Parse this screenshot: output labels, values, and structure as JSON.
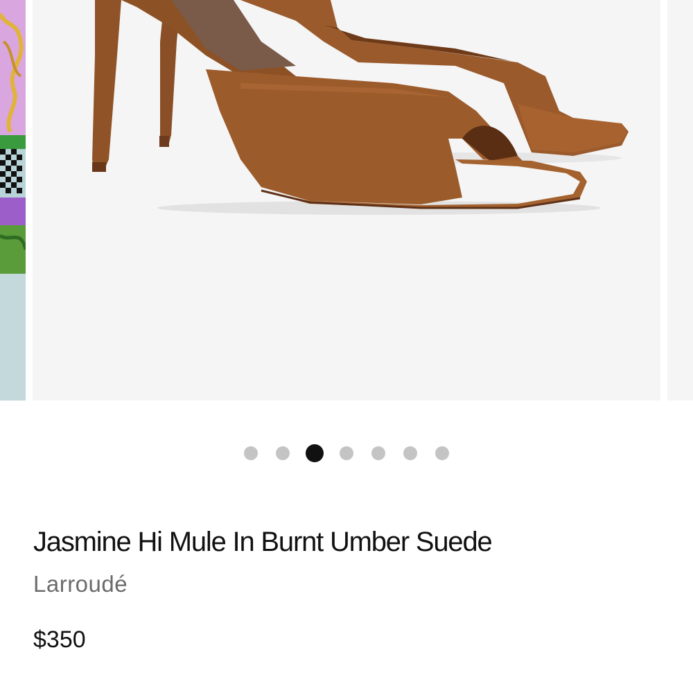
{
  "product": {
    "title": "Jasmine Hi Mule In Burnt Umber Suede",
    "brand": "Larroudé",
    "price": "$350"
  },
  "carousel": {
    "slide_count": 7,
    "active_index": 2,
    "current_image": "brown-suede-mule-photo",
    "previous_image": "colorful-printed-fabric-photo",
    "colors": {
      "dot_inactive": "#c4c4c4",
      "dot_active": "#111111",
      "image_background": "#f5f5f5",
      "suede": "#9a5a2c"
    }
  }
}
